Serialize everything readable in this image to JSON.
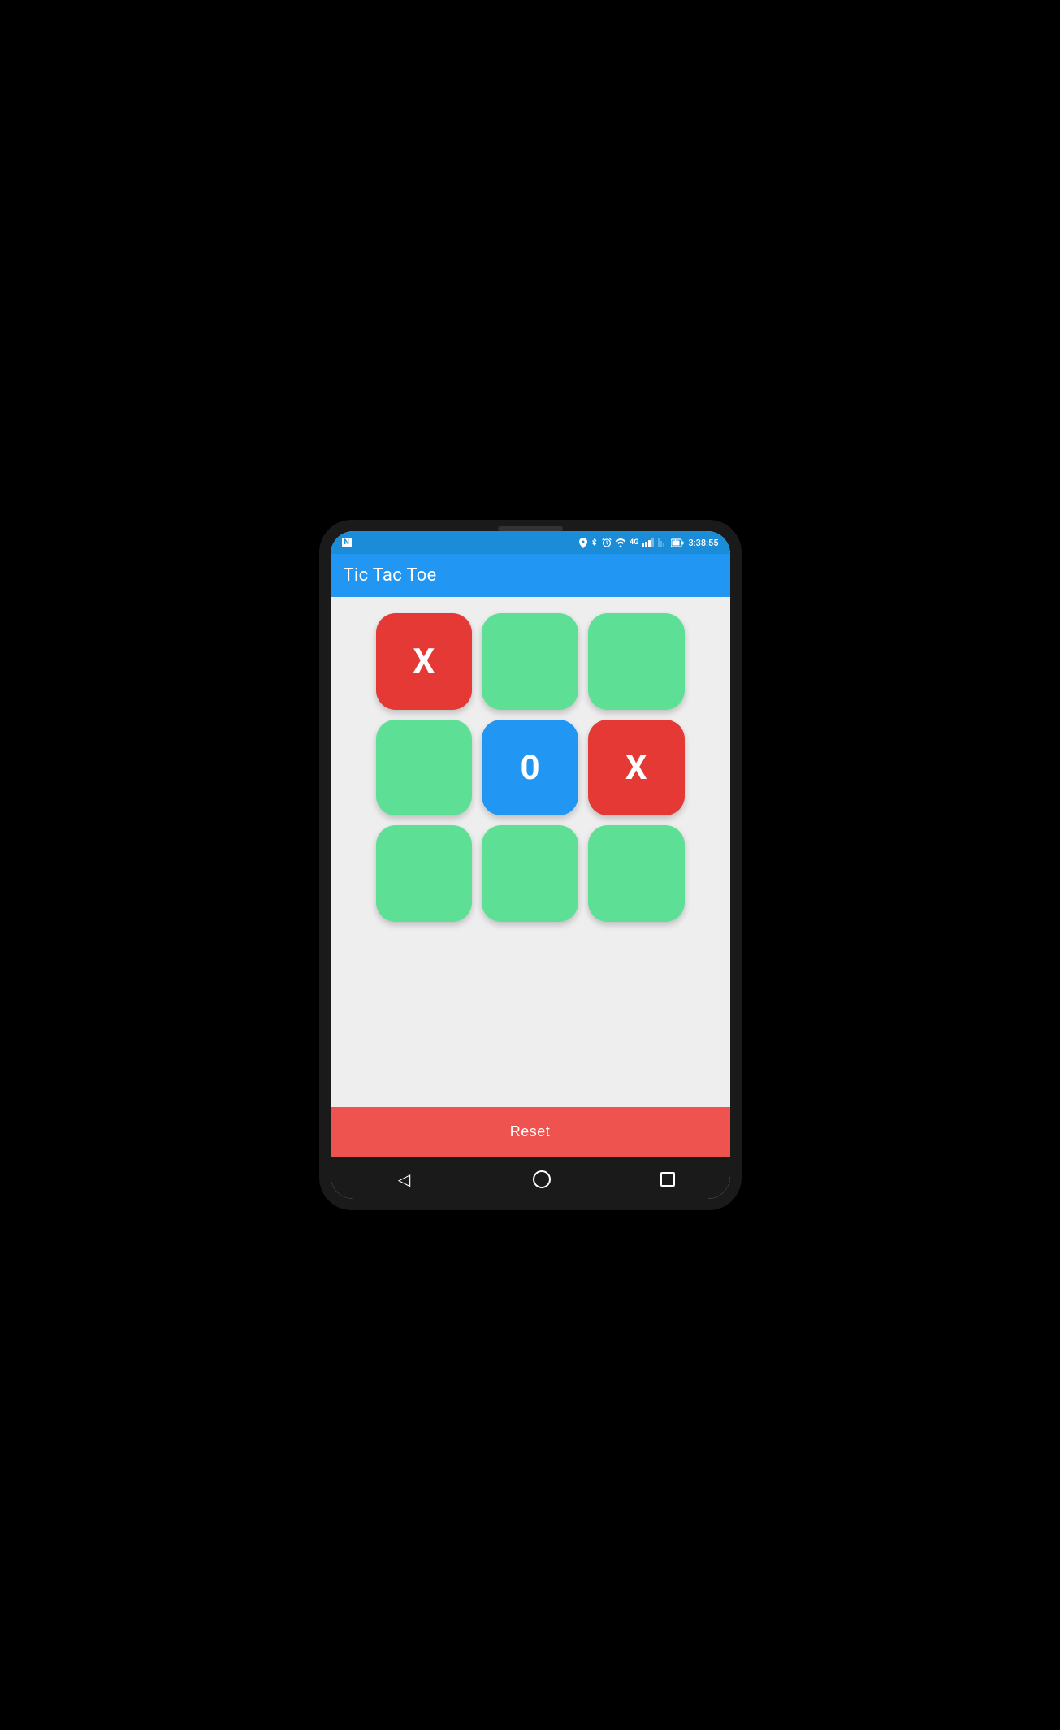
{
  "device": {
    "notch_visible": true
  },
  "status_bar": {
    "time": "3:38:55",
    "signal_label": "4G",
    "n_icon": "N"
  },
  "app_bar": {
    "title": "Tic Tac Toe"
  },
  "game": {
    "board": [
      {
        "row": 0,
        "col": 0,
        "value": "X",
        "type": "x"
      },
      {
        "row": 0,
        "col": 1,
        "value": "",
        "type": "empty"
      },
      {
        "row": 0,
        "col": 2,
        "value": "",
        "type": "empty"
      },
      {
        "row": 1,
        "col": 0,
        "value": "",
        "type": "empty"
      },
      {
        "row": 1,
        "col": 1,
        "value": "0",
        "type": "o"
      },
      {
        "row": 1,
        "col": 2,
        "value": "X",
        "type": "x"
      },
      {
        "row": 2,
        "col": 0,
        "value": "",
        "type": "empty"
      },
      {
        "row": 2,
        "col": 1,
        "value": "",
        "type": "empty"
      },
      {
        "row": 2,
        "col": 2,
        "value": "",
        "type": "empty"
      }
    ],
    "reset_label": "Reset"
  },
  "nav": {
    "back_icon": "◁",
    "home_icon": "○",
    "recent_icon": "□"
  },
  "colors": {
    "app_bar": "#2196f3",
    "status_bar": "#1a8cd8",
    "cell_empty": "#5de095",
    "cell_x": "#e53935",
    "cell_o": "#2196f3",
    "reset_btn": "#ef5350",
    "bg": "#eeeeee"
  }
}
